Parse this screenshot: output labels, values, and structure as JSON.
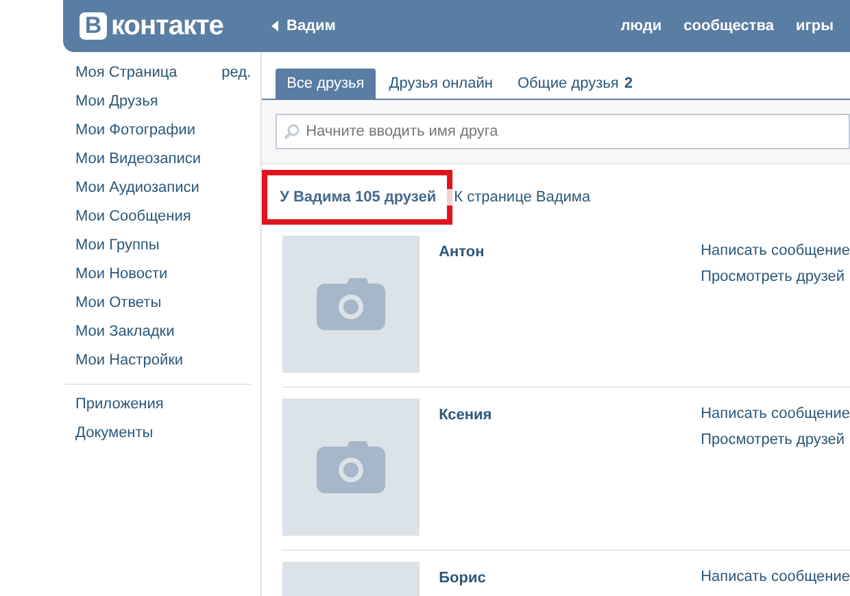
{
  "header": {
    "logo_letter": "В",
    "logo_text": "контакте",
    "back_label": "Вадим",
    "nav": [
      "люди",
      "сообщества",
      "игры"
    ]
  },
  "sidebar": {
    "items": [
      {
        "label": "Моя Страница",
        "edit": "ред."
      },
      {
        "label": "Мои Друзья"
      },
      {
        "label": "Мои Фотографии"
      },
      {
        "label": "Мои Видеозаписи"
      },
      {
        "label": "Мои Аудиозаписи"
      },
      {
        "label": "Мои Сообщения"
      },
      {
        "label": "Мои Группы"
      },
      {
        "label": "Мои Новости"
      },
      {
        "label": "Мои Ответы"
      },
      {
        "label": "Мои Закладки"
      },
      {
        "label": "Мои Настройки"
      }
    ],
    "extra_items": [
      "Приложения",
      "Документы"
    ]
  },
  "tabs": [
    {
      "label": "Все друзья",
      "selected": true
    },
    {
      "label": "Друзья онлайн",
      "selected": false
    },
    {
      "label": "Общие друзья",
      "count": "2",
      "selected": false
    }
  ],
  "search": {
    "placeholder": "Начните вводить имя друга"
  },
  "summary": {
    "count_text": "У Вадима 105 друзей",
    "highlighted": true,
    "link": "К странице Вадима"
  },
  "friends": [
    {
      "name": "Антон",
      "actions": [
        "Написать сообщение",
        "Просмотреть друзей"
      ]
    },
    {
      "name": "Ксения",
      "actions": [
        "Написать сообщение",
        "Просмотреть друзей"
      ]
    },
    {
      "name": "Борис",
      "actions": [
        "Написать сообщение"
      ]
    }
  ]
}
